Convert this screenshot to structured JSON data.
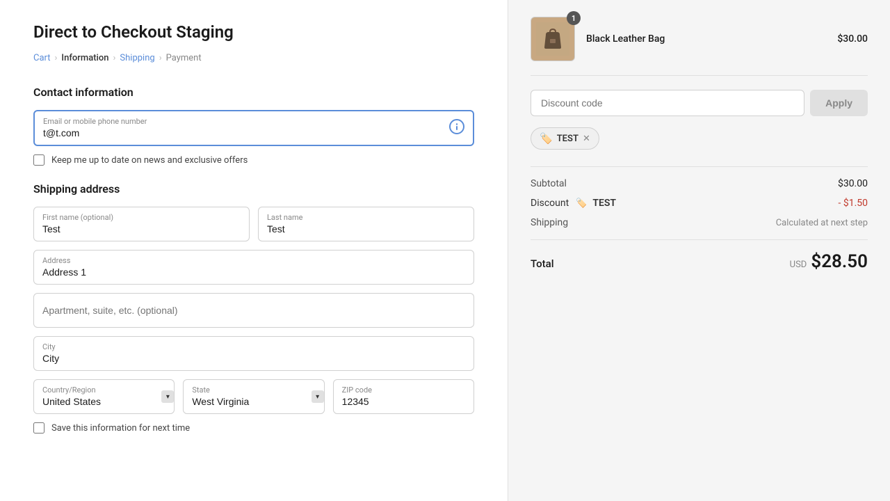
{
  "page": {
    "title": "Direct to Checkout Staging"
  },
  "breadcrumb": {
    "cart": "Cart",
    "information": "Information",
    "shipping": "Shipping",
    "payment": "Payment"
  },
  "contact": {
    "section_title": "Contact information",
    "email_label": "Email or mobile phone number",
    "email_value": "t@t.com",
    "newsletter_label": "Keep me up to date on news and exclusive offers"
  },
  "shipping": {
    "section_title": "Shipping address",
    "first_name_label": "First name (optional)",
    "first_name_value": "Test",
    "last_name_label": "Last name",
    "last_name_value": "Test",
    "address_label": "Address",
    "address_value": "Address 1",
    "apt_label": "Apartment, suite, etc. (optional)",
    "apt_value": "",
    "city_label": "City",
    "city_value": "City",
    "country_label": "Country/Region",
    "country_value": "United States",
    "state_label": "State",
    "state_value": "West Virginia",
    "zip_label": "ZIP code",
    "zip_value": "12345",
    "save_label": "Save this information for next time"
  },
  "order": {
    "product_name": "Black Leather Bag",
    "product_price": "$30.00",
    "badge_count": "1",
    "discount_placeholder": "Discount code",
    "apply_label": "Apply",
    "coupon_code": "TEST",
    "subtotal_label": "Subtotal",
    "subtotal_value": "$30.00",
    "discount_label": "Discount",
    "discount_code": "TEST",
    "discount_value": "- $1.50",
    "shipping_label": "Shipping",
    "shipping_value": "Calculated at next step",
    "total_label": "Total",
    "total_currency": "USD",
    "total_value": "$28.50"
  }
}
